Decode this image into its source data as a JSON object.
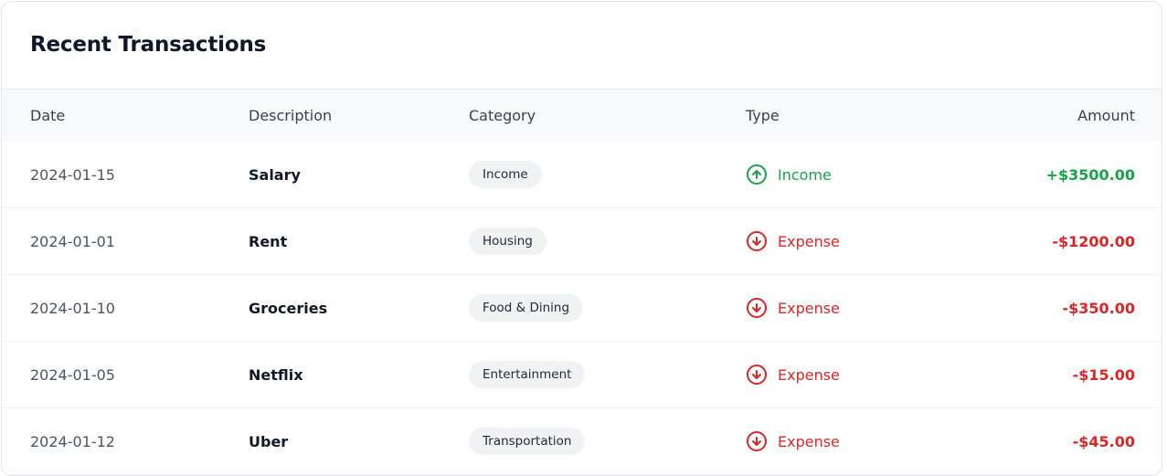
{
  "card": {
    "title": "Recent Transactions"
  },
  "table": {
    "headers": {
      "date": "Date",
      "description": "Description",
      "category": "Category",
      "type": "Type",
      "amount": "Amount"
    },
    "rows": [
      {
        "date": "2024-01-15",
        "description": "Salary",
        "category": "Income",
        "type": "Income",
        "type_icon": "arrow-up-circle-icon",
        "amount": "+$3500.00",
        "kind": "income"
      },
      {
        "date": "2024-01-01",
        "description": "Rent",
        "category": "Housing",
        "type": "Expense",
        "type_icon": "arrow-down-circle-icon",
        "amount": "-$1200.00",
        "kind": "expense"
      },
      {
        "date": "2024-01-10",
        "description": "Groceries",
        "category": "Food & Dining",
        "type": "Expense",
        "type_icon": "arrow-down-circle-icon",
        "amount": "-$350.00",
        "kind": "expense"
      },
      {
        "date": "2024-01-05",
        "description": "Netflix",
        "category": "Entertainment",
        "type": "Expense",
        "type_icon": "arrow-down-circle-icon",
        "amount": "-$15.00",
        "kind": "expense"
      },
      {
        "date": "2024-01-12",
        "description": "Uber",
        "category": "Transportation",
        "type": "Expense",
        "type_icon": "arrow-down-circle-icon",
        "amount": "-$45.00",
        "kind": "expense"
      }
    ]
  },
  "colors": {
    "income": "#16a34a",
    "expense": "#dc2626",
    "badge_bg": "#f1f2f4",
    "header_bg": "#f8f9fb"
  }
}
